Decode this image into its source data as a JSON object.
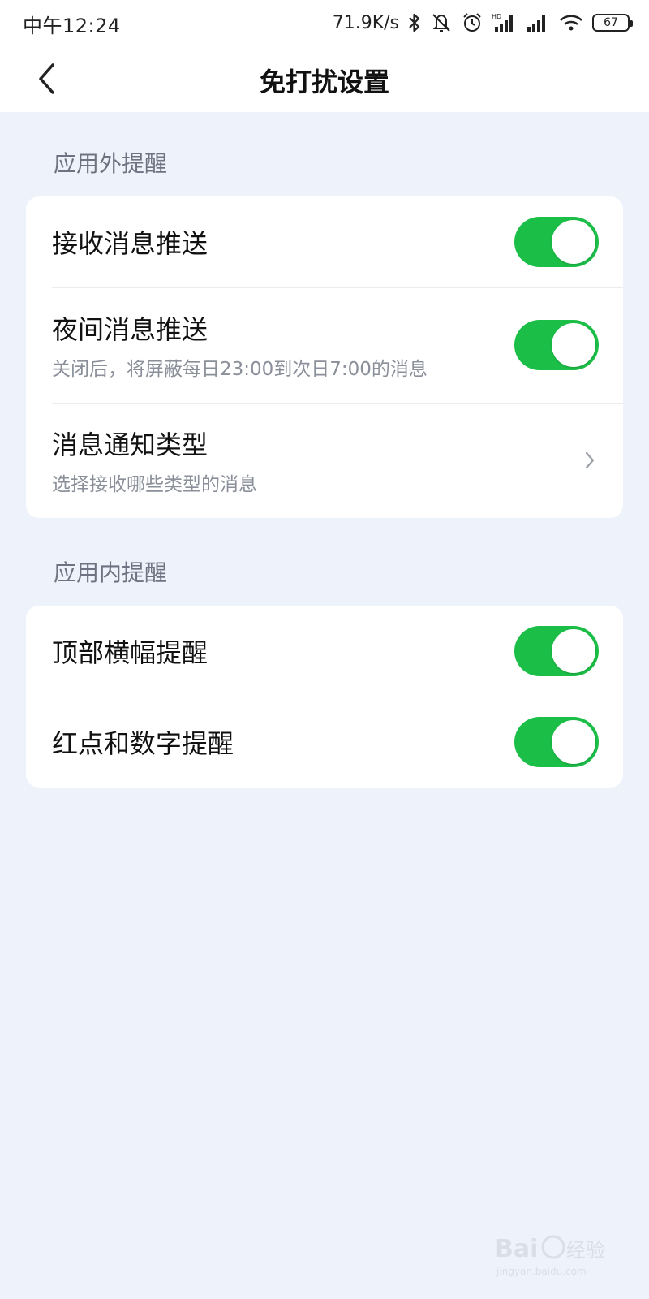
{
  "status_bar": {
    "time": "中午12:24",
    "net_speed": "71.9K/s",
    "battery": "67"
  },
  "header": {
    "title": "免打扰设置"
  },
  "sections": [
    {
      "header": "应用外提醒",
      "items": [
        {
          "title": "接收消息推送",
          "toggle": true
        },
        {
          "title": "夜间消息推送",
          "subtitle": "关闭后，将屏蔽每日23:00到次日7:00的消息",
          "toggle": true
        },
        {
          "title": "消息通知类型",
          "subtitle": "选择接收哪些类型的消息",
          "chevron": true
        }
      ]
    },
    {
      "header": "应用内提醒",
      "items": [
        {
          "title": "顶部横幅提醒",
          "toggle": true
        },
        {
          "title": "红点和数字提醒",
          "toggle": true
        }
      ]
    }
  ],
  "colors": {
    "toggle_on": "#1bbf47",
    "background": "#eef3fb",
    "card": "#ffffff",
    "section_text": "#6d7380"
  },
  "watermark": {
    "text": "Bai 经验",
    "sub": "jingyan.baidu.com"
  }
}
